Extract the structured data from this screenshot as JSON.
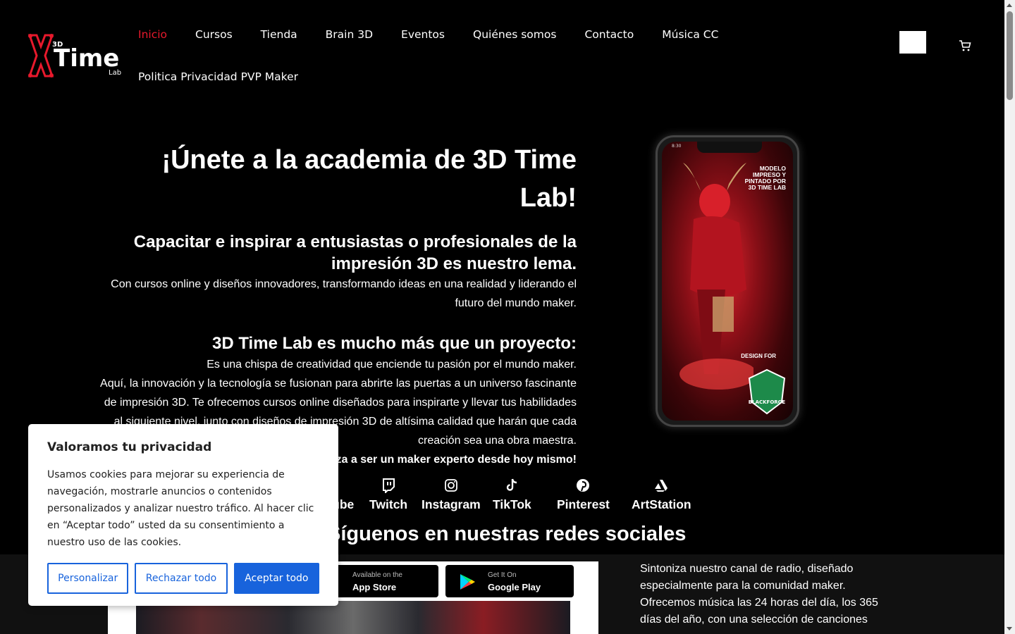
{
  "header": {
    "logo_text": "3D Time Lab",
    "nav_items": [
      "Inicio",
      "Cursos",
      "Tienda",
      "Brain 3D",
      "Eventos",
      "Quiénes somos",
      "Contacto",
      "Música CC",
      "Politica Privacidad PVP Maker"
    ],
    "active_nav": "Inicio"
  },
  "hero": {
    "title": "¡Únete a la academia de 3D Time Lab!",
    "subtitle": "Capacitar e inspirar a entusiastas o profesionales de la impresión 3D es nuestro lema.",
    "intro": "Con cursos online y diseños innovadores, transformando ideas en una realidad y liderando el futuro del mundo maker.",
    "section_title": "3D Time Lab es mucho más que un proyecto:",
    "line1": "Es una chispa de creatividad que enciende tu pasión por el mundo maker.",
    "line2": "Aquí, la innovación y la tecnología se fusionan para abrirte las puertas a un universo fascinante de impresión 3D. Te ofrecemos cursos online diseñados para inspirarte y llevar tus habilidades al siguiente nivel, junto con diseños de impresión 3D de altísima calidad que harán que cada creación sea una obra maestra.",
    "cta": "¡Comienza a ser un maker experto desde hoy mismo!"
  },
  "phone": {
    "status_time": "8:30",
    "title": "MODELO IMPRESO Y PINTADO POR 3D TIME LAB",
    "design_for": "DESIGN FOR",
    "badge": "BLACK FORGE GAMES"
  },
  "social": {
    "items": [
      {
        "label": "YouTube",
        "icon": "youtube-icon"
      },
      {
        "label": "Twitch",
        "icon": "twitch-icon"
      },
      {
        "label": "Instagram",
        "icon": "instagram-icon"
      },
      {
        "label": "TikTok",
        "icon": "tiktok-icon"
      },
      {
        "label": "Pinterest",
        "icon": "pinterest-icon"
      },
      {
        "label": "ArtStation",
        "icon": "artstation-icon"
      }
    ],
    "title": "Síguenos en nuestras redes sociales"
  },
  "radio": {
    "app_store_small": "Available on the",
    "app_store_big": "App Store",
    "google_small": "Get It On",
    "google_big": "Google Play",
    "text": "Sintoniza nuestro canal de radio, diseñado especialmente para la comunidad maker. Ofrecemos música las 24 horas del día, los 365 días del año, con una selección de canciones"
  },
  "cookie": {
    "title": "Valoramos tu privacidad",
    "body": "Usamos cookies para mejorar su experiencia de navegación, mostrarle anuncios o contenidos personalizados y analizar nuestro tráfico. Al hacer clic en “Aceptar todo” usted da su consentimiento a nuestro uso de las cookies.",
    "customize": "Personalizar",
    "reject": "Rechazar todo",
    "accept": "Aceptar todo"
  },
  "colors": {
    "accent_red": "#e8192c",
    "cookie_blue": "#1863dc",
    "background": "#000000"
  }
}
